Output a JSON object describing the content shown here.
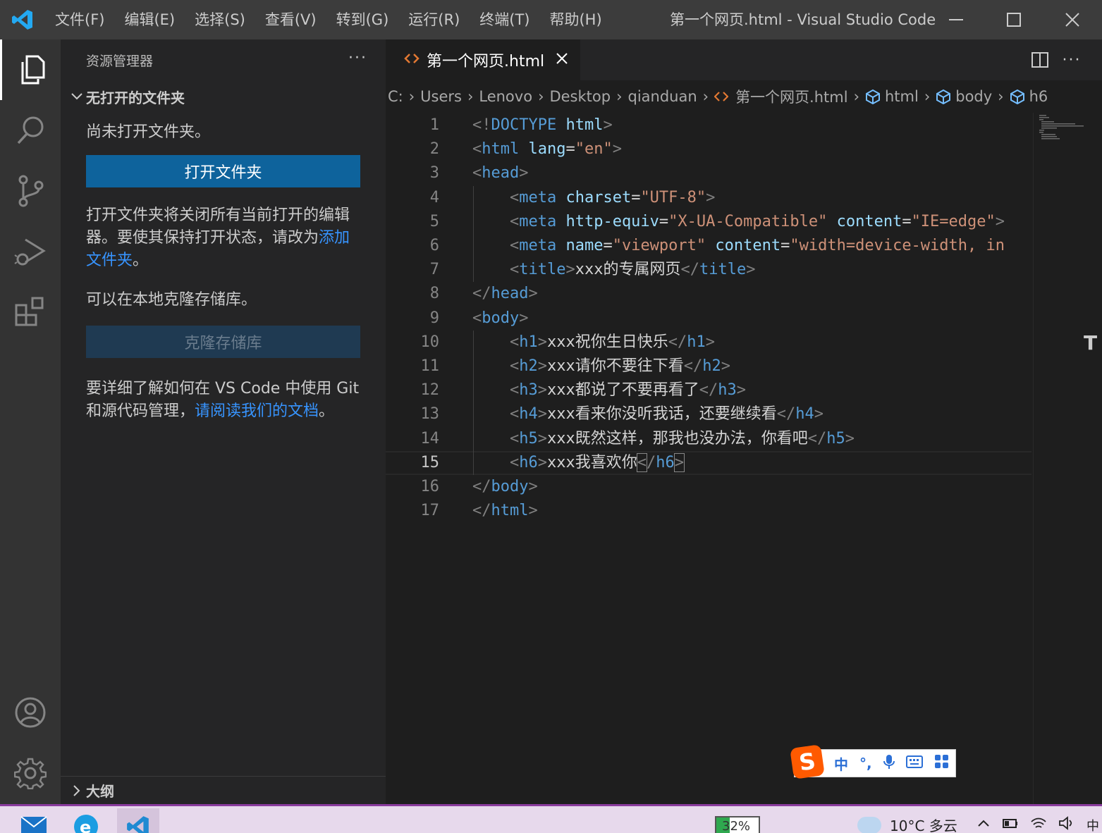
{
  "titlebar": {
    "menu": [
      "文件(F)",
      "编辑(E)",
      "选择(S)",
      "查看(V)",
      "转到(G)",
      "运行(R)",
      "终端(T)",
      "帮助(H)"
    ],
    "window_title": "第一个网页.html - Visual Studio Code"
  },
  "activity_bar": {
    "icons": [
      "files-icon",
      "search-icon",
      "source-control-icon",
      "run-debug-icon",
      "extensions-icon",
      "account-icon",
      "settings-gear-icon"
    ]
  },
  "sidebar": {
    "header": "资源管理器",
    "section_title": "无打开的文件夹",
    "no_folder_text": "尚未打开文件夹。",
    "open_folder_button": "打开文件夹",
    "explain_text": "打开文件夹将关闭所有当前打开的编辑器。要使其保持打开状态，请改为",
    "add_folder_link": "添加文件夹",
    "period": "。",
    "clone_hint": "可以在本地克隆存储库。",
    "clone_button": "克隆存储库",
    "git_text": "要详细了解如何在 VS Code 中使用 Git 和源代码管理，",
    "docs_link": "请阅读我们的文档",
    "outline_title": "大纲"
  },
  "editor": {
    "tab_label": "第一个网页.html",
    "breadcrumb": [
      "C:",
      "Users",
      "Lenovo",
      "Desktop",
      "qianduan",
      "第一个网页.html",
      "html",
      "body",
      "h6"
    ],
    "current_line": 15,
    "line_numbers": [
      "1",
      "2",
      "3",
      "4",
      "5",
      "6",
      "7",
      "8",
      "9",
      "10",
      "11",
      "12",
      "13",
      "14",
      "15",
      "16",
      "17"
    ],
    "lines": [
      "<!DOCTYPE html>",
      "<html lang=\"en\">",
      "<head>",
      "    <meta charset=\"UTF-8\">",
      "    <meta http-equiv=\"X-UA-Compatible\" content=\"IE=edge\">",
      "    <meta name=\"viewport\" content=\"width=device-width, in",
      "    <title>xxx的专属网页</title>",
      "</head>",
      "<body>",
      "    <h1>xxx祝你生日快乐</h1>",
      "    <h2>xxx请你不要往下看</h2>",
      "    <h3>xxx都说了不要再看了</h3>",
      "    <h4>xxx看来你没听我话，还要继续看</h4>",
      "    <h5>xxx既然这样，那我也没办法，你看吧</h5>",
      "    <h6>xxx我喜欢你</h6>",
      "</body>",
      "</html>"
    ]
  },
  "ime": {
    "logo": "S",
    "mode": "中",
    "punct": "°,",
    "icons": [
      "microphone-icon",
      "keyboard-icon",
      "toolbox-icon"
    ]
  },
  "taskbar": {
    "apps": [
      "mail-icon",
      "browser-icon",
      "vscode-icon"
    ],
    "battery": "32%",
    "battery_level": 0.32,
    "weather": "10°C 多云",
    "tray_ime": "中"
  },
  "colors": {
    "titlebar": "#3c3c3c",
    "activitybar": "#333333",
    "sidebar": "#252526",
    "editor": "#1e1e1e",
    "button": "#0e639c",
    "link": "#3794ff",
    "tag": "#569cd6",
    "attr": "#9cdcfe",
    "string": "#ce9178"
  }
}
